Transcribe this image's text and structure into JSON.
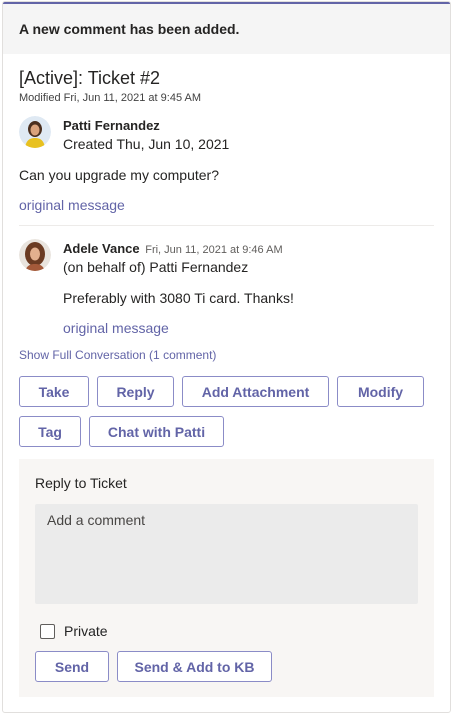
{
  "banner": {
    "text": "A new comment has been added."
  },
  "ticket": {
    "title": "[Active]: Ticket #2",
    "modified": "Modified Fri, Jun 11, 2021 at 9:45 AM",
    "requester": {
      "name": "Patti Fernandez",
      "created": "Created Thu, Jun 10, 2021"
    },
    "message": "Can you upgrade my computer?",
    "original_link": "original message"
  },
  "reply": {
    "author": "Adele Vance",
    "time": "Fri, Jun 11, 2021 at 9:46 AM",
    "behalf": "(on behalf of) Patti Fernandez",
    "message": "Preferably with 3080 Ti card. Thanks!",
    "original_link": "original message"
  },
  "show_full": "Show Full Conversation (1 comment)",
  "actions": {
    "take": "Take",
    "reply": "Reply",
    "add_attachment": "Add Attachment",
    "modify": "Modify",
    "tag": "Tag",
    "chat": "Chat with Patti"
  },
  "reply_panel": {
    "title": "Reply to Ticket",
    "comment_placeholder": "Add a comment",
    "private_label": "Private",
    "send": "Send",
    "send_kb": "Send & Add to KB"
  },
  "colors": {
    "accent": "#6264a7",
    "panel_bg": "#f8f6f4",
    "banner_bg": "#f5f5f5"
  }
}
